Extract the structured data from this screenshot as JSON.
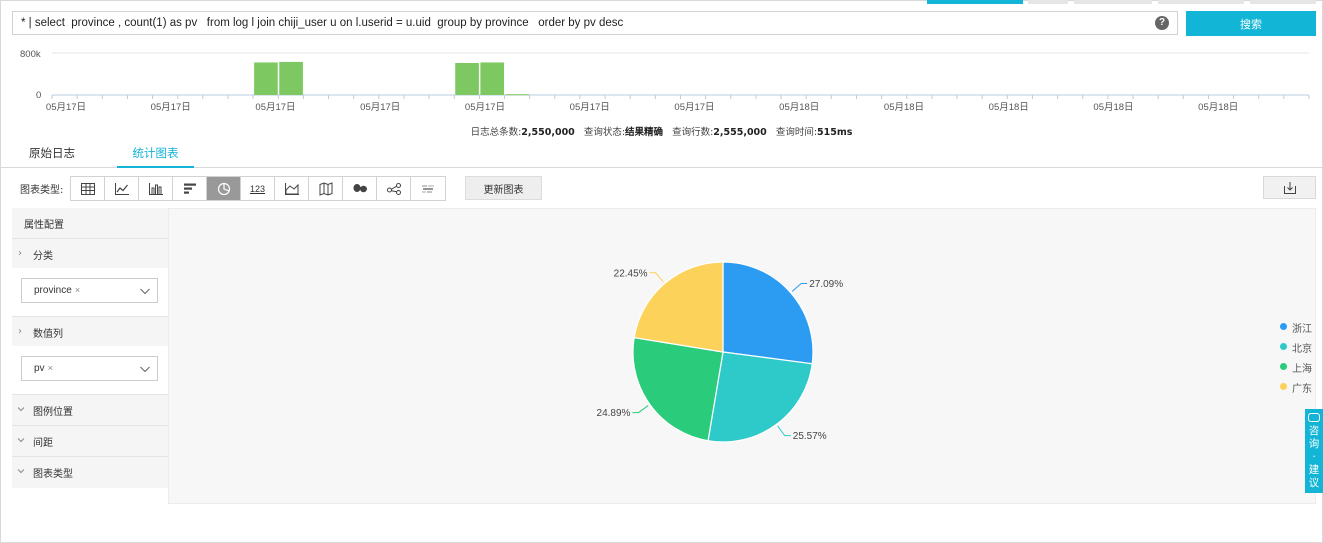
{
  "query": {
    "text": "* | select  province , count(1) as pv   from log l join chiji_user u on l.userid = u.uid  group by province   order by pv desc",
    "help_glyph": "?",
    "search_label": "搜索"
  },
  "histogram": {
    "y_ticks": [
      "800k",
      "0"
    ],
    "x_labels": [
      "05月17日",
      "05月17日",
      "05月17日",
      "05月17日",
      "05月17日",
      "05月17日",
      "05月17日",
      "05月18日",
      "05月18日",
      "05月18日",
      "05月18日",
      "05月18日"
    ],
    "bars": [
      {
        "index": 8,
        "value": 620000
      },
      {
        "index": 9,
        "value": 630000
      },
      {
        "index": 16,
        "value": 610000
      },
      {
        "index": 17,
        "value": 620000
      },
      {
        "index": 18,
        "value": 15000
      }
    ],
    "bar_count": 50,
    "ymax": 800000,
    "bar_color": "#7dc860"
  },
  "summary": {
    "total_label": "日志总条数:",
    "total_value": "2,550,000",
    "status_label": "查询状态:",
    "status_value": "结果精确",
    "rows_label": "查询行数:",
    "rows_value": "2,555,000",
    "time_label": "查询时间:",
    "time_value": "515ms"
  },
  "tabs": [
    {
      "label": "原始日志",
      "active": false
    },
    {
      "label": "统计图表",
      "active": true
    }
  ],
  "toolbar": {
    "label": "图表类型:",
    "chart_types": [
      {
        "icon": "table-icon",
        "active": false
      },
      {
        "icon": "line-chart-icon",
        "active": false
      },
      {
        "icon": "column-chart-icon",
        "active": false
      },
      {
        "icon": "bar-chart-icon",
        "active": false
      },
      {
        "icon": "pie-chart-icon",
        "active": true
      },
      {
        "icon": "number-icon",
        "active": false,
        "text": "123"
      },
      {
        "icon": "area-chart-icon",
        "active": false
      },
      {
        "icon": "map-icon",
        "active": false
      },
      {
        "icon": "world-map-icon",
        "active": false
      },
      {
        "icon": "flow-chart-icon",
        "active": false
      },
      {
        "icon": "word-cloud-icon",
        "active": false
      }
    ],
    "update_label": "更新图表",
    "download_icon": "download-icon"
  },
  "config": {
    "title": "属性配置",
    "sections": {
      "category": {
        "label": "分类",
        "tag": "province"
      },
      "value": {
        "label": "数值列",
        "tag": "pv"
      },
      "legend_position": {
        "label": "图例位置"
      },
      "spacing": {
        "label": "间距"
      },
      "chart_type": {
        "label": "图表类型"
      }
    },
    "tag_remove": "×",
    "chevron": "›"
  },
  "chart_data": {
    "type": "pie",
    "categories": [
      "浙江",
      "北京",
      "上海",
      "广东"
    ],
    "values": [
      27.09,
      25.57,
      24.89,
      22.45
    ],
    "labels": [
      "27.09%",
      "25.57%",
      "24.89%",
      "22.45%"
    ],
    "colors": [
      "#2c9cf3",
      "#2ec9c9",
      "#2acb7a",
      "#fcd25a"
    ],
    "legend_position": "right"
  },
  "consult": {
    "chars": [
      "咨",
      "询",
      "·",
      "建",
      "议"
    ]
  }
}
